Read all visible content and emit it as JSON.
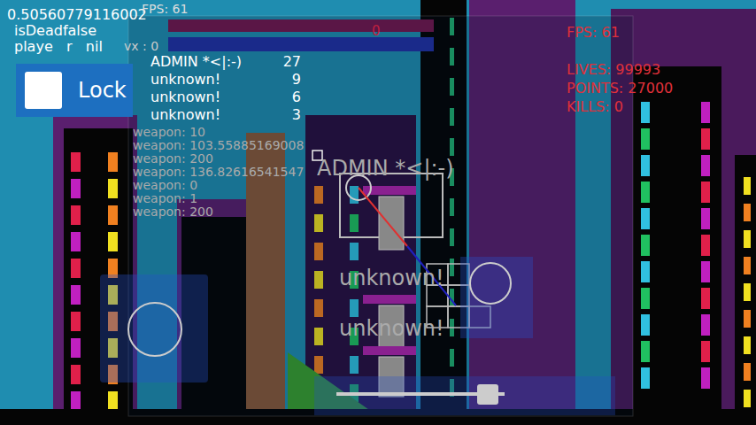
{
  "debug": {
    "lines": [
      "0.50560779116002",
      "isDeadfalse",
      "playe   r   nil"
    ],
    "fps": "FPS: 61",
    "vx": "vx : 0"
  },
  "lock": {
    "label": "Lock",
    "checked": false
  },
  "scoreboard": [
    {
      "name": "ADMIN *<|:-)",
      "score": "27"
    },
    {
      "name": "unknown!",
      "score": "9"
    },
    {
      "name": "unknown!",
      "score": "6"
    },
    {
      "name": "unknown!",
      "score": "3"
    }
  ],
  "weapons": [
    "weapon: 10",
    "weapon: 103.55885169008",
    "weapon: 200",
    "weapon: 136.82616541547",
    "weapon: 0",
    "weapon: 1",
    "weapon: 200"
  ],
  "health_bars": [
    {
      "level": 1,
      "color": "#5a1646"
    },
    {
      "level": 1,
      "color": "#1a2a8a"
    }
  ],
  "center_counter": "0",
  "stats": {
    "fps": "FPS: 61",
    "lives": "LIVES: 99993",
    "points": "POINTS: 27000",
    "kills": "KILLS: 0"
  },
  "players": [
    {
      "name": "ADMIN *<|:-)"
    },
    {
      "name": "unknown!"
    },
    {
      "name": "unknown!"
    }
  ],
  "slider": {
    "level": 0.9
  }
}
